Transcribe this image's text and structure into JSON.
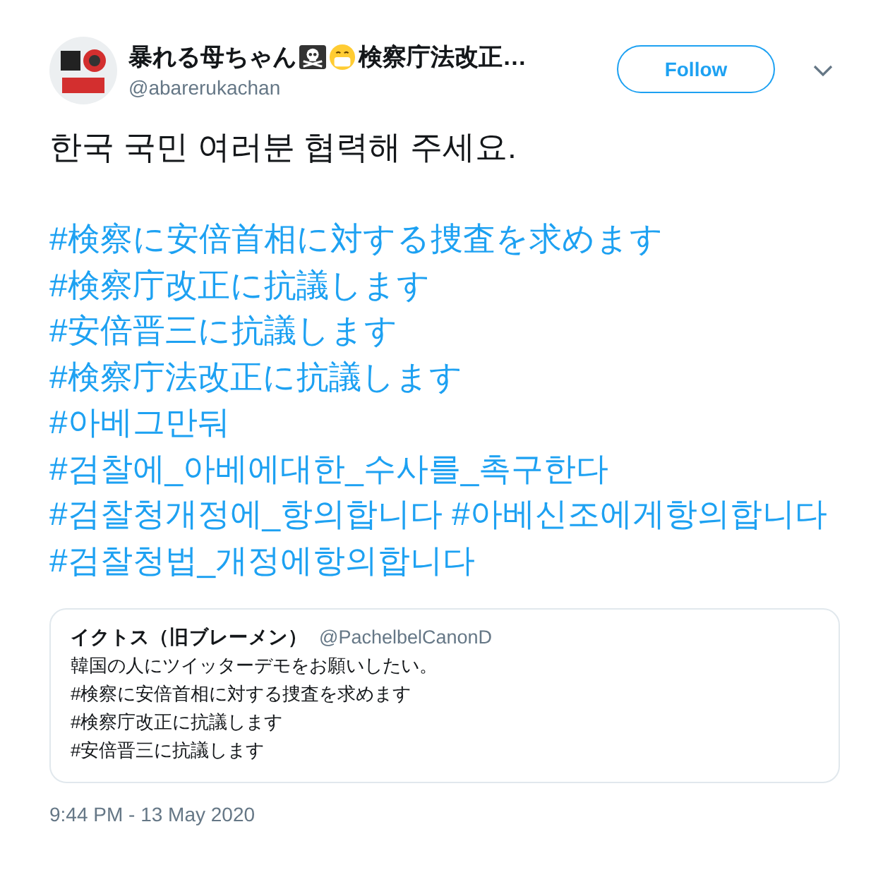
{
  "author": {
    "name": "暴れる母ちゃん",
    "name_suffix": "検察庁法改正…",
    "handle": "@abarerukachan"
  },
  "follow_button": {
    "label": "Follow"
  },
  "tweet": {
    "text": "한국 국민 여러분 협력해 주세요.",
    "hashtag_lines": [
      [
        "#検察に安倍首相に対する捜査を求めます"
      ],
      [
        "#検察庁改正に抗議します"
      ],
      [
        "#安倍晋三に抗議します"
      ],
      [
        "#検察庁法改正に抗議します"
      ],
      [
        "#아베그만둬"
      ],
      [
        "#검찰에_아베에대한_수사를_촉구한다"
      ],
      [
        "#검찰청개정에_항의합니다",
        "#아베신조에게항의합니다"
      ],
      [
        "#검찰청법_개정에항의합니다"
      ]
    ]
  },
  "quoted_tweet": {
    "name": "イクトス（旧ブレーメン）",
    "handle": "@PachelbelCanonD",
    "lines": [
      "韓国の人にツイッターデモをお願いしたい。",
      "#検察に安倍首相に対する捜査を求めます",
      "#検察庁改正に抗議します",
      "#安倍晋三に抗議します"
    ]
  },
  "timestamp": "9:44 PM - 13 May 2020"
}
